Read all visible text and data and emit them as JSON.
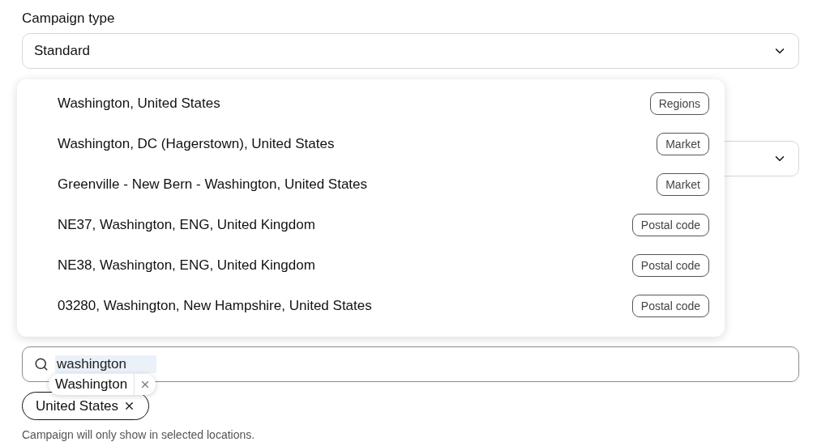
{
  "campaign_type": {
    "label": "Campaign type",
    "value": "Standard"
  },
  "location_search": {
    "value": "washington"
  },
  "suggestions": [
    {
      "name": "Washington, United States",
      "type": "Regions"
    },
    {
      "name": "Washington, DC (Hagerstown), United States",
      "type": "Market"
    },
    {
      "name": "Greenville - New Bern - Washington, United States",
      "type": "Market"
    },
    {
      "name": "NE37, Washington, ENG, United Kingdom",
      "type": "Postal code"
    },
    {
      "name": "NE38, Washington, ENG, United Kingdom",
      "type": "Postal code"
    },
    {
      "name": "03280, Washington, New Hampshire, United States",
      "type": "Postal code"
    }
  ],
  "tooltip": {
    "text": "Washington"
  },
  "selected_locations": [
    {
      "label": "United States"
    }
  ],
  "helper": "Campaign will only show in selected locations."
}
